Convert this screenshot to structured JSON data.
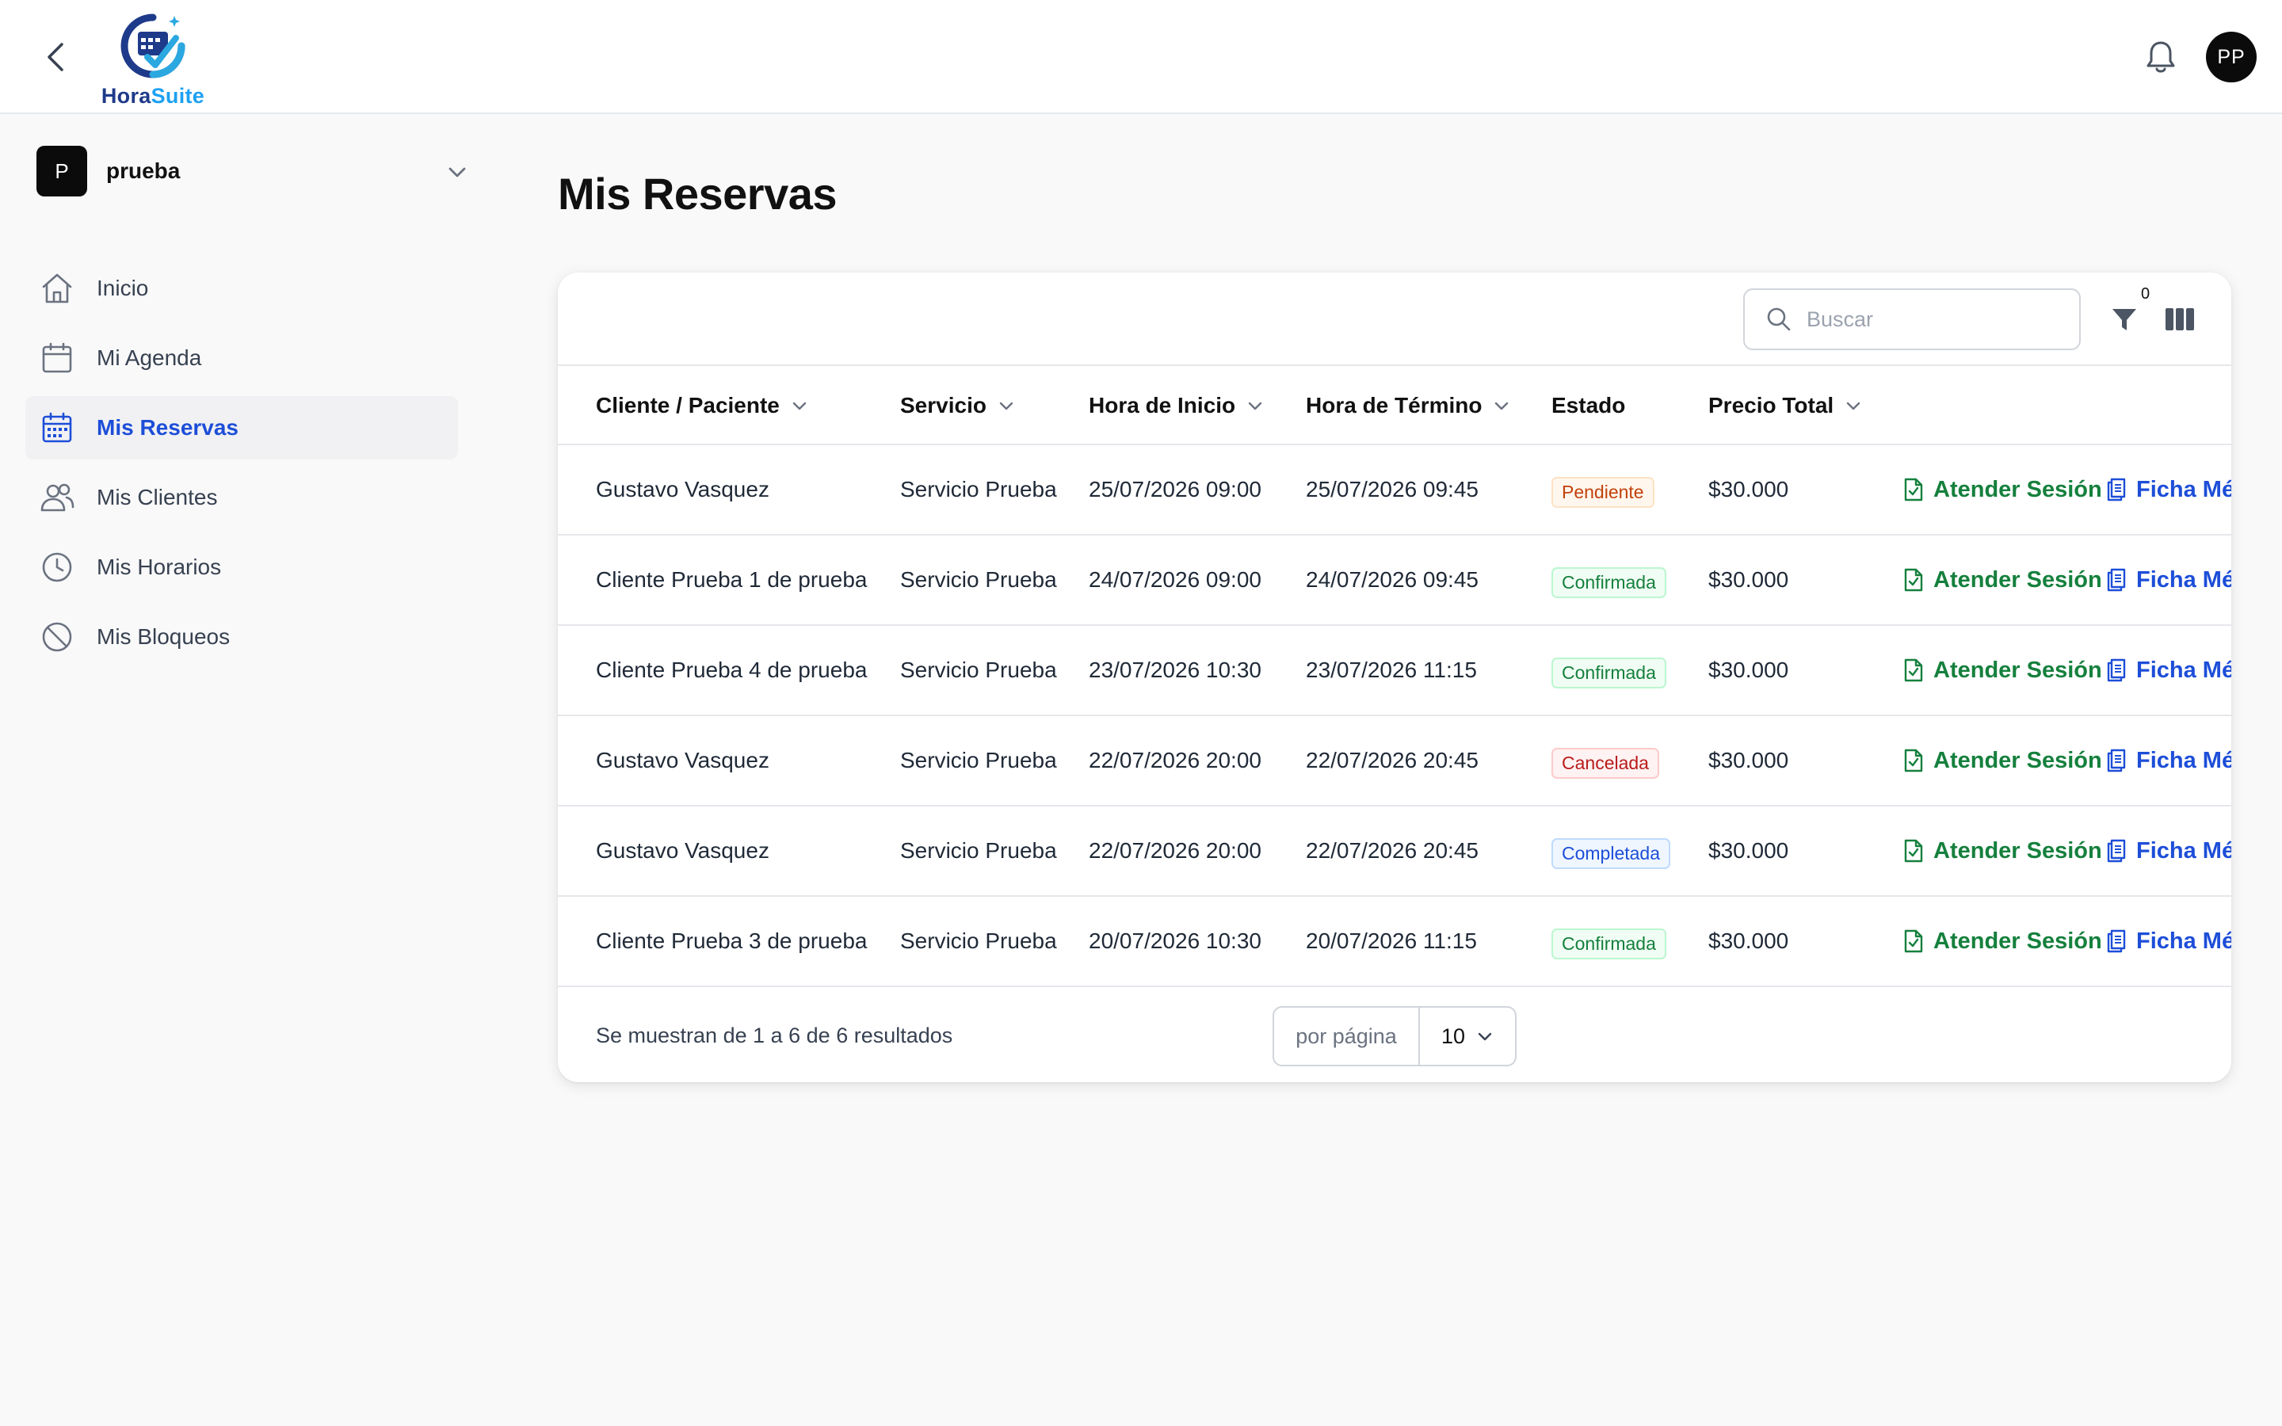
{
  "header": {
    "logo": {
      "name_part1": "Hora",
      "name_part2": "Suite"
    },
    "avatar_initials": "PP"
  },
  "workspace": {
    "initial": "P",
    "name": "prueba"
  },
  "sidebar": {
    "items": [
      {
        "label": "Inicio",
        "icon": "home-icon",
        "active": false
      },
      {
        "label": "Mi Agenda",
        "icon": "calendar-icon",
        "active": false
      },
      {
        "label": "Mis Reservas",
        "icon": "calendar-grid-icon",
        "active": true
      },
      {
        "label": "Mis Clientes",
        "icon": "users-icon",
        "active": false
      },
      {
        "label": "Mis Horarios",
        "icon": "clock-icon",
        "active": false
      },
      {
        "label": "Mis Bloqueos",
        "icon": "block-icon",
        "active": false
      }
    ]
  },
  "page": {
    "title": "Mis Reservas"
  },
  "toolbar": {
    "search_placeholder": "Buscar",
    "filter_count": "0"
  },
  "table": {
    "columns": [
      "Cliente / Paciente",
      "Servicio",
      "Hora de Inicio",
      "Hora de Término",
      "Estado",
      "Precio Total"
    ],
    "rows": [
      {
        "cliente": "Gustavo Vasquez",
        "servicio": "Servicio Prueba",
        "inicio": "25/07/2026 09:00",
        "termino": "25/07/2026 09:45",
        "estado": "Pendiente",
        "precio": "$30.000"
      },
      {
        "cliente": "Cliente Prueba 1 de prueba",
        "servicio": "Servicio Prueba",
        "inicio": "24/07/2026 09:00",
        "termino": "24/07/2026 09:45",
        "estado": "Confirmada",
        "precio": "$30.000"
      },
      {
        "cliente": "Cliente Prueba 4 de prueba",
        "servicio": "Servicio Prueba",
        "inicio": "23/07/2026 10:30",
        "termino": "23/07/2026 11:15",
        "estado": "Confirmada",
        "precio": "$30.000"
      },
      {
        "cliente": "Gustavo Vasquez",
        "servicio": "Servicio Prueba",
        "inicio": "22/07/2026 20:00",
        "termino": "22/07/2026 20:45",
        "estado": "Cancelada",
        "precio": "$30.000"
      },
      {
        "cliente": "Gustavo Vasquez",
        "servicio": "Servicio Prueba",
        "inicio": "22/07/2026 20:00",
        "termino": "22/07/2026 20:45",
        "estado": "Completada",
        "precio": "$30.000"
      },
      {
        "cliente": "Cliente Prueba 3 de prueba",
        "servicio": "Servicio Prueba",
        "inicio": "20/07/2026 10:30",
        "termino": "20/07/2026 11:15",
        "estado": "Confirmada",
        "precio": "$30.000"
      }
    ],
    "actions": {
      "attend": "Atender Sesión",
      "record": "Ficha Méd"
    }
  },
  "footer": {
    "results_text": "Se muestran de 1 a 6 de 6 resultados",
    "per_page_label": "por página",
    "per_page_value": "10"
  },
  "colors": {
    "accent": "#1d4ed8",
    "success": "#15803d",
    "warning": "#c2410c",
    "danger": "#b91c1c"
  }
}
